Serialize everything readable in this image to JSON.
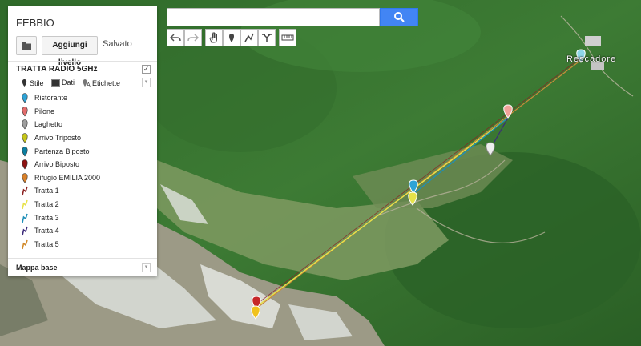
{
  "map_title": "FEBBIO",
  "toolbar": {
    "add_layer_label": "Aggiungi livello",
    "saved_label": "Salvato"
  },
  "layer": {
    "name": "TRATTA RADIO 5GHz",
    "visible": true,
    "options": {
      "style": "Stile",
      "data": "Dati",
      "labels": "Etichette"
    }
  },
  "items": [
    {
      "label": "Ristorante",
      "kind": "marker",
      "color": "#2ea3d6"
    },
    {
      "label": "Pilone",
      "kind": "marker",
      "color": "#e36c6c"
    },
    {
      "label": "Laghetto",
      "kind": "marker",
      "color": "#9e9e9e"
    },
    {
      "label": "Arrivo Triposto",
      "kind": "marker",
      "color": "#c6c61a"
    },
    {
      "label": "Partenza Biposto",
      "kind": "marker",
      "color": "#0b7fa1"
    },
    {
      "label": "Arrivo Biposto",
      "kind": "marker",
      "color": "#8e1313"
    },
    {
      "label": "Rifugio EMILIA 2000",
      "kind": "marker",
      "color": "#d9812a"
    },
    {
      "label": "Tratta 1",
      "kind": "line",
      "color": "#8b2020"
    },
    {
      "label": "Tratta 2",
      "kind": "line",
      "color": "#e8e24a"
    },
    {
      "label": "Tratta 3",
      "kind": "line",
      "color": "#1e8fb8"
    },
    {
      "label": "Tratta 4",
      "kind": "line",
      "color": "#3c2a7a"
    },
    {
      "label": "Tratta 5",
      "kind": "line",
      "color": "#d28a2a"
    }
  ],
  "basemap_label": "Mappa base",
  "search": {
    "value": "",
    "placeholder": ""
  },
  "map_place_label": "Rescadore",
  "tools": [
    "undo-icon",
    "redo-icon",
    "hand-icon",
    "add-marker-icon",
    "draw-line-icon",
    "directions-icon",
    "ruler-icon"
  ]
}
